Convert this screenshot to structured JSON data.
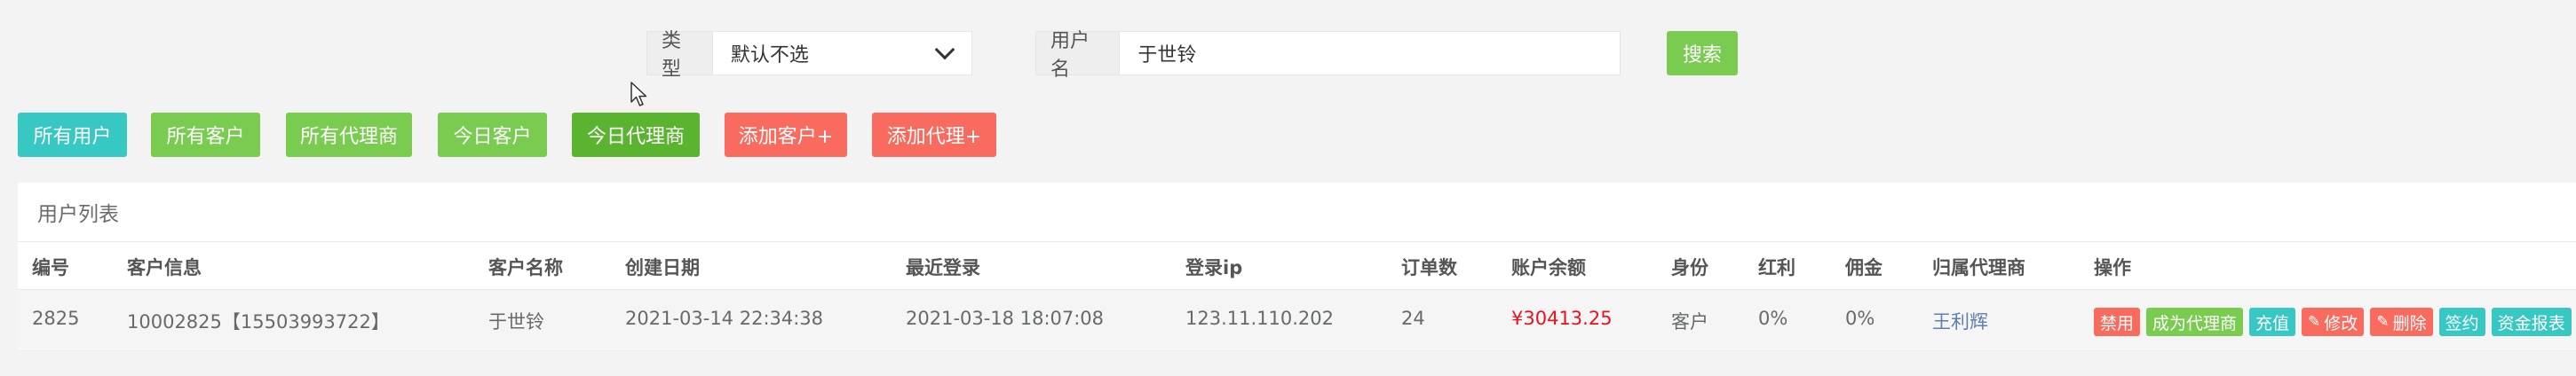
{
  "search": {
    "type_label": "类型",
    "type_value": "默认不选",
    "username_label": "用户名",
    "username_value": "于世铃",
    "search_button": "搜索"
  },
  "filters": [
    {
      "label": "所有用户",
      "color": "#37c8c3"
    },
    {
      "label": "所有客户",
      "color": "#79cc4f"
    },
    {
      "label": "所有代理商",
      "color": "#79cc4f"
    },
    {
      "label": "今日客户",
      "color": "#79cc4f"
    },
    {
      "label": "今日代理商",
      "color": "#5ab42f"
    },
    {
      "label": "添加客户+",
      "color": "#f96b5e"
    },
    {
      "label": "添加代理+",
      "color": "#f96b5e"
    }
  ],
  "panel": {
    "title": "用户列表",
    "columns": [
      "编号",
      "客户信息",
      "客户名称",
      "创建日期",
      "最近登录",
      "登录ip",
      "订单数",
      "账户余额",
      "身份",
      "红利",
      "佣金",
      "归属代理商",
      "操作"
    ],
    "rows": [
      {
        "id": "2825",
        "info": "10002825【15503993722】",
        "name": "于世铃",
        "created": "2021-03-14 22:34:38",
        "last_login": "2021-03-18 18:07:08",
        "ip": "123.11.110.202",
        "orders": "24",
        "balance": "¥30413.25",
        "role": "客户",
        "bonus": "0%",
        "commission": "0%",
        "agent": "王利辉"
      }
    ],
    "actions": [
      {
        "label": "禁用",
        "icon": "",
        "color": "#f96b5e"
      },
      {
        "label": "成为代理商",
        "icon": "",
        "color": "#79cc4f"
      },
      {
        "label": "充值",
        "icon": "",
        "color": "#37c8c3"
      },
      {
        "label": "修改",
        "icon": "pencil-icon",
        "color": "#f96b5e"
      },
      {
        "label": "删除",
        "icon": "pencil-icon",
        "color": "#f96b5e"
      },
      {
        "label": "签约",
        "icon": "",
        "color": "#37c8c3"
      },
      {
        "label": "资金报表",
        "icon": "",
        "color": "#37c8c3"
      }
    ]
  }
}
